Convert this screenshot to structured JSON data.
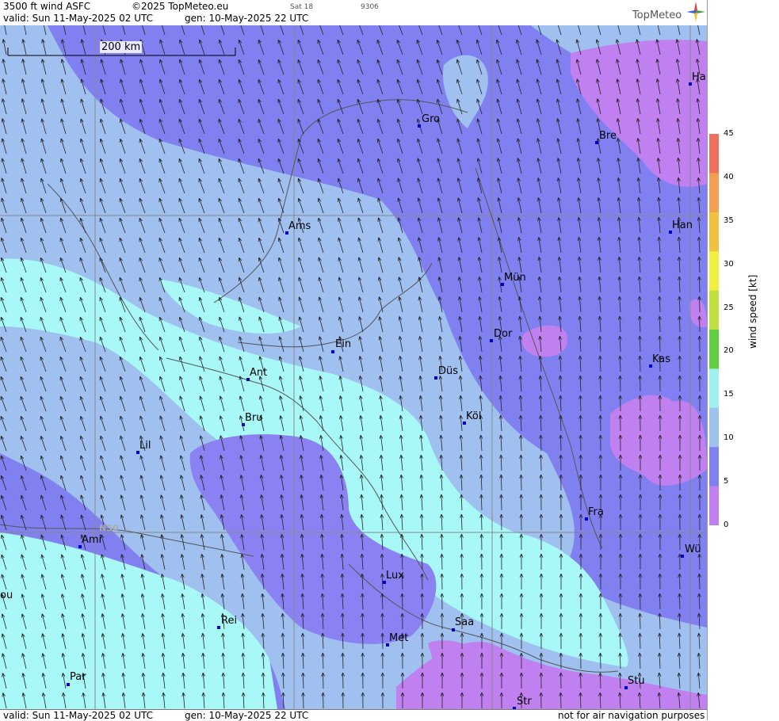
{
  "header": {
    "title": "3500 ft wind ASFC",
    "copyright": "©2025 TopMeteo.eu",
    "valid": "valid:  Sun  11-May-2025  02 UTC",
    "gen": "gen: 10-May-2025 22 UTC",
    "sat": "Sat 18",
    "code": "9306",
    "logo": "TopMeteo"
  },
  "footer": {
    "valid": "valid:  Sun  11-May-2025  02 UTC",
    "gen": "gen: 10-May-2025 22 UTC",
    "disclaimer": "not for air navigation purposes"
  },
  "scale_bar": {
    "label": "200 km"
  },
  "lat_label": "N50",
  "colorbar": {
    "title": "wind speed  [kt]",
    "ticks": [
      "45",
      "40",
      "35",
      "30",
      "25",
      "20",
      "15",
      "10",
      "5",
      "0"
    ],
    "colors": [
      "#f07060",
      "#f0a050",
      "#f0c040",
      "#f0f040",
      "#c0e040",
      "#60d040",
      "#a0f0f0",
      "#a0c0f0",
      "#8080f0",
      "#c080f0"
    ]
  },
  "cities": [
    {
      "name": "Gro"
    },
    {
      "name": "Bre"
    },
    {
      "name": "Ha"
    },
    {
      "name": "Ams"
    },
    {
      "name": "Han"
    },
    {
      "name": "Mün"
    },
    {
      "name": "Dor"
    },
    {
      "name": "Ein"
    },
    {
      "name": "Kas"
    },
    {
      "name": "Düs"
    },
    {
      "name": "Ant"
    },
    {
      "name": "Köl"
    },
    {
      "name": "Bru"
    },
    {
      "name": "Lil"
    },
    {
      "name": "Fra"
    },
    {
      "name": "Ami"
    },
    {
      "name": "Wü"
    },
    {
      "name": "Lux"
    },
    {
      "name": "ou"
    },
    {
      "name": "Rei"
    },
    {
      "name": "Saa"
    },
    {
      "name": "Met"
    },
    {
      "name": "Par"
    },
    {
      "name": "Stu"
    },
    {
      "name": "Str"
    }
  ]
}
